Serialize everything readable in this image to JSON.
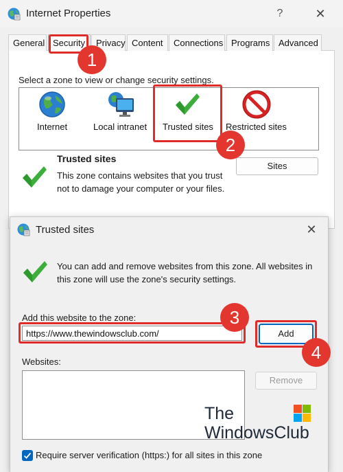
{
  "outer_window": {
    "title": "Internet Properties",
    "help_glyph": "?",
    "close_glyph": "✕"
  },
  "tabs": [
    "General",
    "Security",
    "Privacy",
    "Content",
    "Connections",
    "Programs",
    "Advanced"
  ],
  "active_tab": "Security",
  "security": {
    "zone_prompt": "Select a zone to view or change security settings.",
    "zones": [
      {
        "label": "Internet",
        "icon": "globe-icon"
      },
      {
        "label": "Local intranet",
        "icon": "network-monitor-icon"
      },
      {
        "label": "Trusted sites",
        "icon": "green-checkmark-icon"
      },
      {
        "label": "Restricted sites",
        "icon": "no-entry-icon"
      }
    ],
    "selected_zone": "Trusted sites",
    "zone_heading": "Trusted sites",
    "zone_description": "This zone contains websites that you trust not to damage your computer or your files.",
    "sites_button": "Sites"
  },
  "trusted_sites_dialog": {
    "title": "Trusted sites",
    "close_glyph": "✕",
    "description": "You can add and remove websites from this zone. All websites in this zone will use the zone's security settings.",
    "add_label": "Add this website to the zone:",
    "url_value": "https://www.thewindowsclub.com/",
    "add_button": "Add",
    "websites_label": "Websites:",
    "websites": [],
    "remove_button": "Remove",
    "verification_checked": true,
    "verification_label": "Require server verification (https:) for all sites in this zone"
  },
  "annotations": [
    "1",
    "2",
    "3",
    "4"
  ],
  "annotation_color": "#e3362f",
  "accent_color": "#0067c0",
  "watermark": {
    "line1": "The",
    "line2": "WindowsClub"
  }
}
